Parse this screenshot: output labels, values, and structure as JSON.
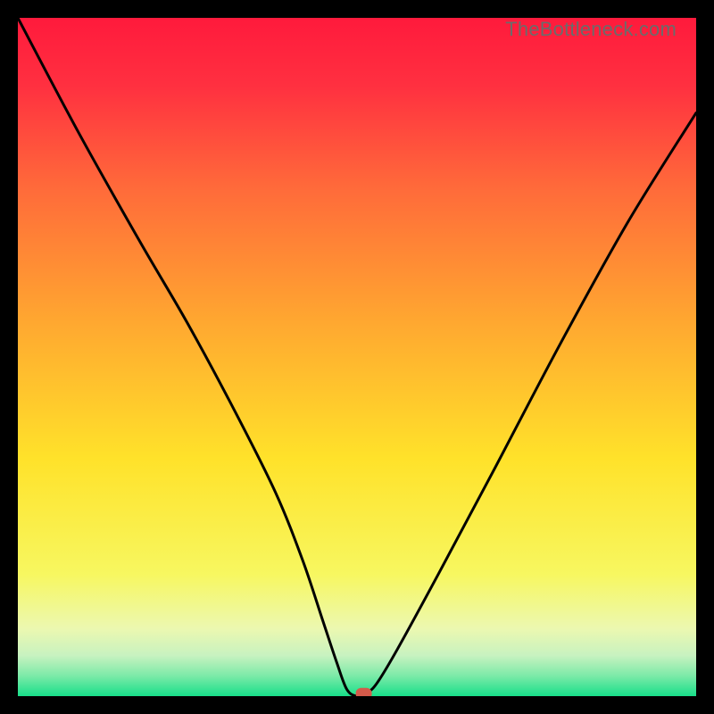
{
  "watermark": "TheBottleneck.com",
  "chart_data": {
    "type": "line",
    "title": "",
    "xlabel": "",
    "ylabel": "",
    "xlim": [
      0,
      100
    ],
    "ylim": [
      0,
      100
    ],
    "series": [
      {
        "name": "curve",
        "x": [
          0,
          9,
          18,
          25,
          32,
          38,
          42,
          45,
          47,
          48.5,
          50,
          51.5,
          53,
          56,
          62,
          70,
          80,
          90,
          100
        ],
        "values": [
          100,
          83,
          67,
          55,
          42,
          30,
          20,
          11,
          5,
          1,
          0,
          0.5,
          2,
          7,
          18,
          33,
          52,
          70,
          86
        ]
      }
    ],
    "marker": {
      "x": 51,
      "y": 0.3
    },
    "gradient_stops": [
      {
        "offset": 0.0,
        "color": "#ff1a3c"
      },
      {
        "offset": 0.1,
        "color": "#ff3040"
      },
      {
        "offset": 0.25,
        "color": "#ff6a3a"
      },
      {
        "offset": 0.45,
        "color": "#ffa830"
      },
      {
        "offset": 0.65,
        "color": "#ffe22a"
      },
      {
        "offset": 0.82,
        "color": "#f7f760"
      },
      {
        "offset": 0.9,
        "color": "#ecf8b0"
      },
      {
        "offset": 0.94,
        "color": "#c8f2c0"
      },
      {
        "offset": 0.97,
        "color": "#7ceaa8"
      },
      {
        "offset": 1.0,
        "color": "#18df8a"
      }
    ],
    "background_box": {
      "x0": 0,
      "y0": 0,
      "x1": 100,
      "y1": 100
    }
  }
}
